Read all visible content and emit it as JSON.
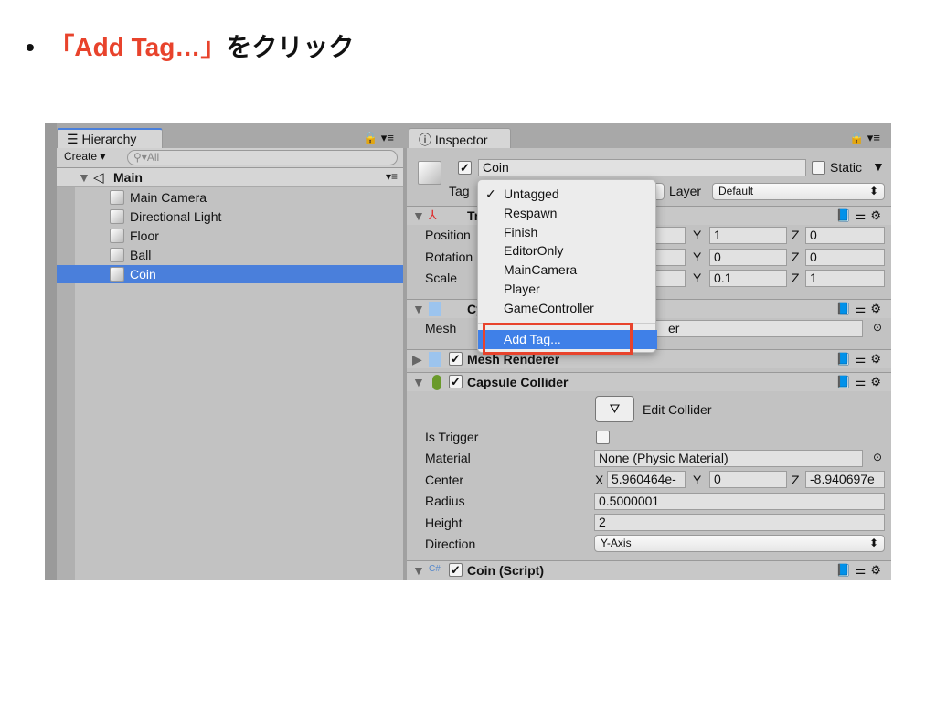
{
  "instruction": {
    "bullet": "•",
    "quote_open": "「",
    "highlight": "Add Tag…",
    "quote_close": "」",
    "suffix": "をクリック"
  },
  "hierarchy": {
    "tab": "Hierarchy",
    "create": "Create",
    "search_placeholder": "All",
    "scene": "Main",
    "items": [
      "Main Camera",
      "Directional Light",
      "Floor",
      "Ball",
      "Coin"
    ],
    "selected": "Coin"
  },
  "inspector": {
    "tab": "Inspector",
    "name": "Coin",
    "active": true,
    "static_label": "Static",
    "tag_label": "Tag",
    "layer_label": "Layer",
    "layer_value": "Default",
    "transform": {
      "title": "Tr",
      "rows": [
        {
          "label": "Position",
          "y": "1",
          "z": "0"
        },
        {
          "label": "Rotation",
          "y": "0",
          "z": "0"
        },
        {
          "label": "Scale",
          "y": "0.1",
          "z": "1"
        }
      ]
    },
    "mesh_filter": {
      "title": "Cy",
      "mesh_label": "Mesh",
      "mesh_value": "er"
    },
    "mesh_renderer": {
      "title": "Mesh Renderer"
    },
    "capsule": {
      "title": "Capsule Collider",
      "edit": "Edit Collider",
      "is_trigger": "Is Trigger",
      "material_label": "Material",
      "material": "None (Physic Material)",
      "center_label": "Center",
      "cx": "5.960464e-",
      "cy": "0",
      "cz": "-8.940697e",
      "radius_label": "Radius",
      "radius": "0.5000001",
      "height_label": "Height",
      "height": "2",
      "direction_label": "Direction",
      "direction": "Y-Axis"
    },
    "script": {
      "title": "Coin (Script)"
    }
  },
  "tag_menu": {
    "items": [
      "Untagged",
      "Respawn",
      "Finish",
      "EditorOnly",
      "MainCamera",
      "Player",
      "GameController"
    ],
    "checked": "Untagged",
    "add": "Add Tag..."
  },
  "colors": {
    "highlight_red": "#e8432c",
    "selection_blue": "#4a7fdb",
    "menu_blue": "#3f80e8"
  }
}
